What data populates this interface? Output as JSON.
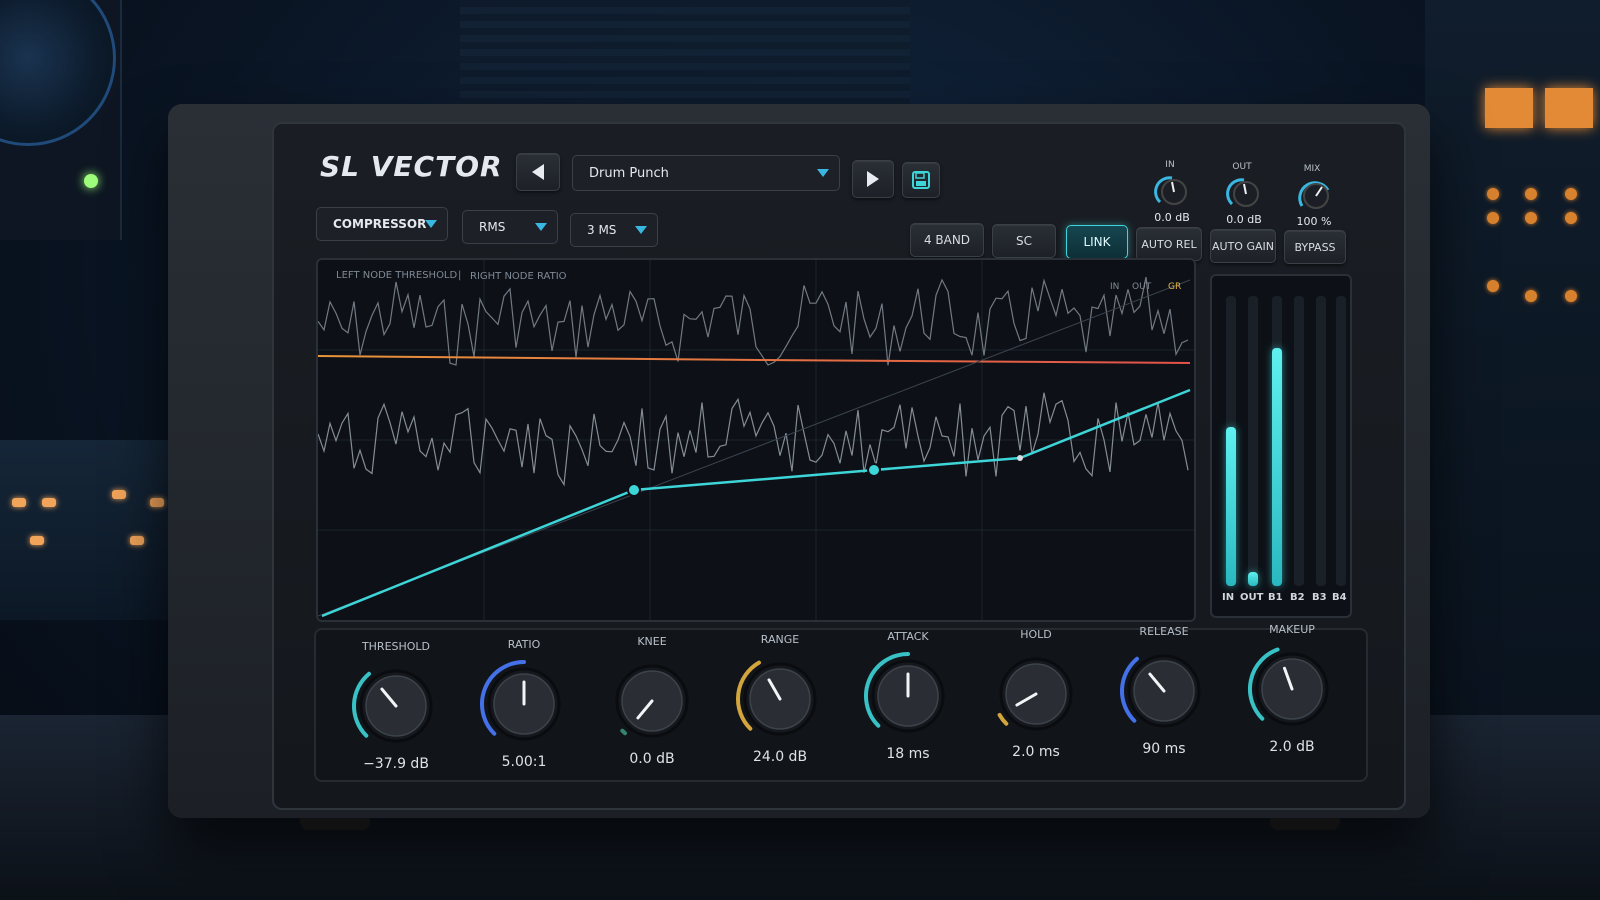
{
  "app": {
    "logo": "SL VECTOR"
  },
  "preset": {
    "name": "Drum Punch"
  },
  "selectors": {
    "mode": "COMPRESSOR",
    "detection": "RMS",
    "lookahead": "3 MS"
  },
  "io": [
    {
      "label": "IN",
      "value": "0.0 dB"
    },
    {
      "label": "OUT",
      "value": "0.0 dB"
    },
    {
      "label": "MIX",
      "value": "100 %"
    }
  ],
  "toggles": [
    {
      "label": "4 BAND",
      "active": false
    },
    {
      "label": "SC",
      "active": false
    },
    {
      "label": "LINK",
      "active": true
    },
    {
      "label": "AUTO REL",
      "active": false
    },
    {
      "label": "AUTO GAIN",
      "active": false
    },
    {
      "label": "BYPASS",
      "active": false
    }
  ],
  "graph": {
    "hint_left": "LEFT NODE THRESHOLD",
    "hint_sep": "|",
    "hint_right": "RIGHT NODE RATIO",
    "legend_in": "IN",
    "legend_out": "OUT",
    "legend_gr": "GR"
  },
  "meters": [
    {
      "label": "IN",
      "level": 0.55
    },
    {
      "label": "OUT",
      "level": 0.05
    },
    {
      "label": "B1",
      "level": 0.82
    },
    {
      "label": "B2",
      "level": 0
    },
    {
      "label": "B3",
      "level": 0
    },
    {
      "label": "B4",
      "level": 0
    }
  ],
  "knobs": [
    {
      "label": "THRESHOLD",
      "value": "−37.9 dB"
    },
    {
      "label": "RATIO",
      "value": "5.00:1"
    },
    {
      "label": "KNEE",
      "value": "0.0 dB"
    },
    {
      "label": "RANGE",
      "value": "24.0 dB"
    },
    {
      "label": "ATTACK",
      "value": "18 ms"
    },
    {
      "label": "HOLD",
      "value": "2.0 ms"
    },
    {
      "label": "RELEASE",
      "value": "90 ms"
    },
    {
      "label": "MAKEUP",
      "value": "2.0 dB"
    }
  ],
  "colors": {
    "accent": "#3dd5d8",
    "knob_blue": "#4a7bff",
    "knob_gold": "#e8b640",
    "curve_orange": "#e8943a",
    "curve_red": "#e2514a"
  },
  "icons": {
    "prev": "triangle-left-icon",
    "next": "triangle-right-icon",
    "save": "floppy-disk-icon",
    "dropdown": "chevron-down-icon"
  }
}
